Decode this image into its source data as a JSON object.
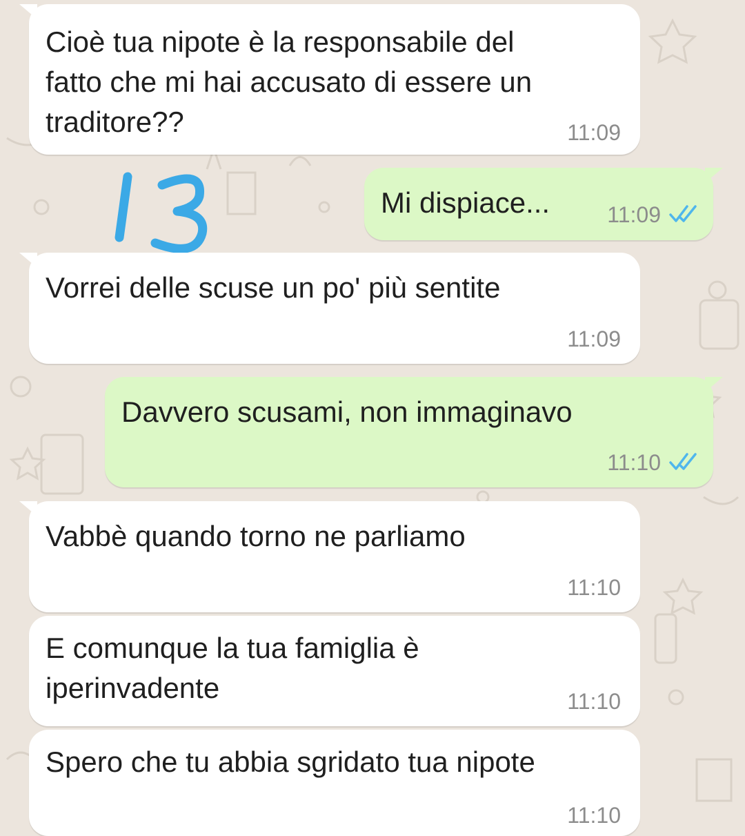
{
  "chat": {
    "messages": [
      {
        "direction": "incoming",
        "text": "Cioè tua nipote è la responsabile del\nfatto che mi hai accusato di essere un\ntraditore??",
        "time": "11:09"
      },
      {
        "direction": "outgoing",
        "text": "Mi dispiace...",
        "time": "11:09",
        "status": "read-double-check"
      },
      {
        "direction": "incoming",
        "text": "Vorrei delle scuse un po' più sentite",
        "time": "11:09"
      },
      {
        "direction": "outgoing",
        "text": "Davvero scusami, non immaginavo",
        "time": "11:10",
        "status": "read-double-check"
      },
      {
        "direction": "incoming",
        "text": "Vabbè quando torno ne parliamo",
        "time": "11:10"
      },
      {
        "direction": "incoming",
        "text": "E comunque la tua famiglia è\niperinvadente",
        "time": "11:10"
      },
      {
        "direction": "incoming",
        "text": "Spero che tu abbia sgridato tua nipote",
        "time": "11:10"
      }
    ]
  },
  "annotation": {
    "text": "13",
    "color": "#3BA9E6"
  },
  "theme": {
    "background": "#ECE5DD",
    "incoming_bubble": "#FFFFFF",
    "outgoing_bubble": "#DCF8C6",
    "read_tick": "#4FB6EC",
    "timestamp": "#8C8C8C"
  },
  "icons": {
    "read_receipt": "double-check-icon"
  }
}
